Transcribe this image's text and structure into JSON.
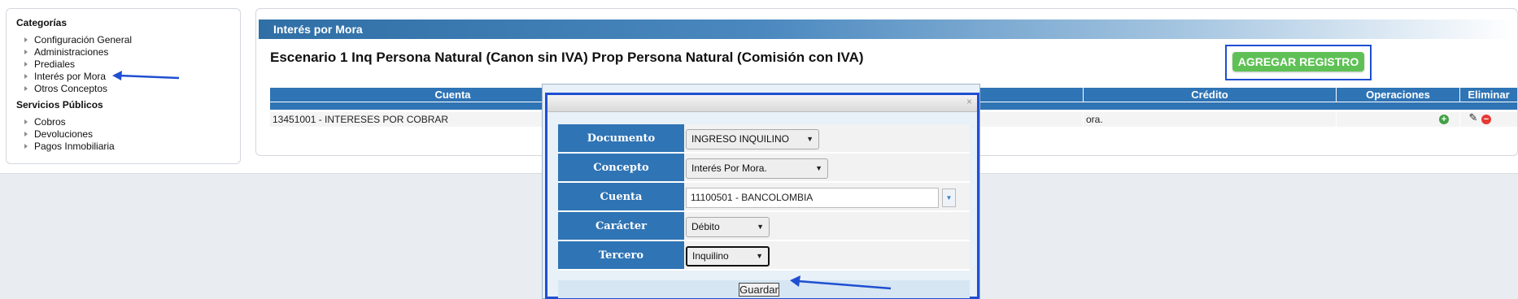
{
  "sidebar": {
    "categories_title": "Categorías",
    "categories": [
      {
        "label": "Configuración General"
      },
      {
        "label": "Administraciones"
      },
      {
        "label": "Prediales"
      },
      {
        "label": "Interés por Mora"
      },
      {
        "label": "Otros Conceptos"
      }
    ],
    "services_title": "Servicios Públicos",
    "services": [
      {
        "label": "Cobros"
      },
      {
        "label": "Devoluciones"
      },
      {
        "label": "Pagos Inmobiliaria"
      }
    ]
  },
  "main": {
    "header": "Interés por Mora",
    "scenario": "Escenario 1 Inq Persona Natural (Canon sin IVA) Prop Persona Natural (Comisión con IVA)",
    "add_button": "AGREGAR REGISTRO",
    "columns": {
      "cuenta": "Cuenta",
      "credito": "Crédito",
      "operaciones": "Operaciones",
      "eliminar": "Eliminar"
    },
    "row": {
      "cuenta": "13451001 - INTERESES POR COBRAR",
      "credito": "ora."
    }
  },
  "dialog": {
    "close": "×",
    "fields": {
      "documento": {
        "label": "Documento",
        "value": "INGRESO INQUILINO"
      },
      "concepto": {
        "label": "Concepto",
        "value": "Interés Por Mora."
      },
      "cuenta": {
        "label": "Cuenta",
        "value": "11100501 - BANCOLOMBIA"
      },
      "caracter": {
        "label": "Carácter",
        "value": "Débito"
      },
      "tercero": {
        "label": "Tercero",
        "value": "Inquilino"
      }
    },
    "save_button": "Guardar"
  },
  "colors": {
    "header_blue": "#2f74b5",
    "add_green": "#5fc155",
    "highlight_blue": "#1f4fd1"
  }
}
